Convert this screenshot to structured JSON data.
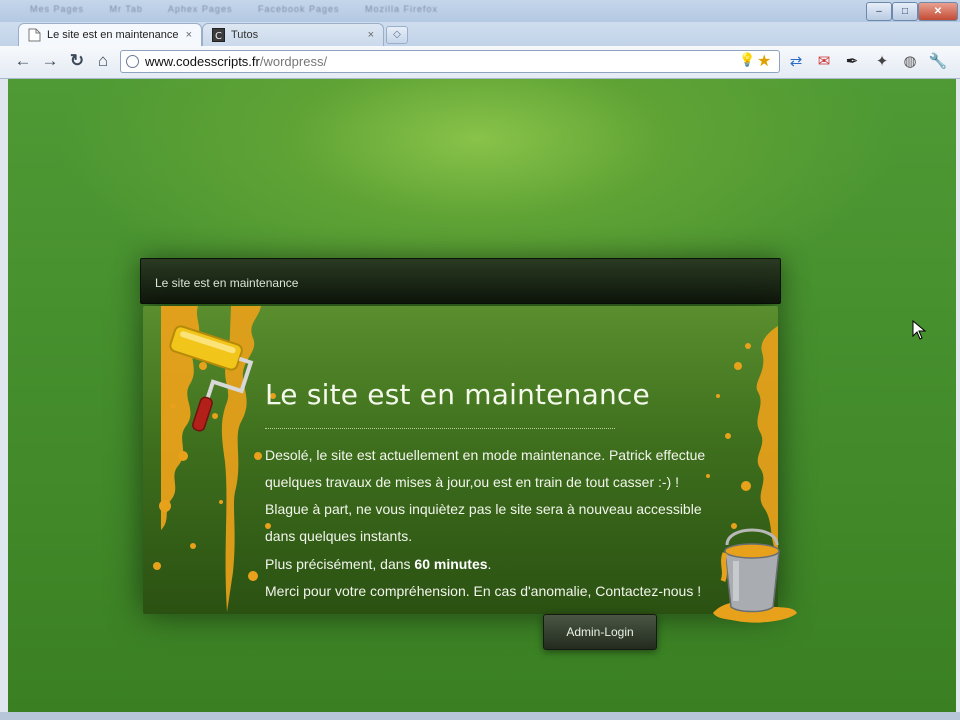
{
  "browser": {
    "background_tabs": [
      "Mes Pages",
      "Mr Tab",
      "Aphex Pages",
      "Facebook Pages",
      "Mozilla Firefox"
    ],
    "window_controls": {
      "minimize": "–",
      "maximize": "□",
      "close": "✕"
    },
    "tabs": [
      {
        "label": "Le site est en maintenance",
        "close": "×",
        "active": true
      },
      {
        "label": "Tutos",
        "close": "×",
        "active": false
      }
    ],
    "new_tab": "◇",
    "nav": {
      "back": "←",
      "forward": "→",
      "reload": "↻",
      "home": "⌂"
    },
    "address": {
      "host": "www.codesscripts.fr",
      "path": "/wordpress/"
    },
    "extension_icons": [
      "translate-icon",
      "gmail-icon",
      "ink-icon",
      "puzzle-icon",
      "globe-icon",
      "wrench-icon"
    ]
  },
  "page": {
    "header_title": "Le site est en maintenance",
    "content_title": "Le site est en maintenance",
    "messages": [
      "Desolé, le site est actuellement en mode maintenance. Patrick effectue",
      "quelques travaux de mises à jour,ou est en train de tout casser :-) !",
      "Blague à part, ne vous inquiètez pas le site sera à nouveau accessible",
      "dans quelques instants."
    ],
    "precise_prefix": "Plus précisément, dans ",
    "precise_bold": "60 minutes",
    "precise_suffix": ".",
    "thanks": "Merci pour votre compréhension. En cas d'anomalie, Contactez-nous !",
    "admin_button": "Admin-Login"
  },
  "colors": {
    "page_green": "#4f9a35",
    "paint_orange": "#e8a11a",
    "panel_dark": "#1c2816"
  }
}
